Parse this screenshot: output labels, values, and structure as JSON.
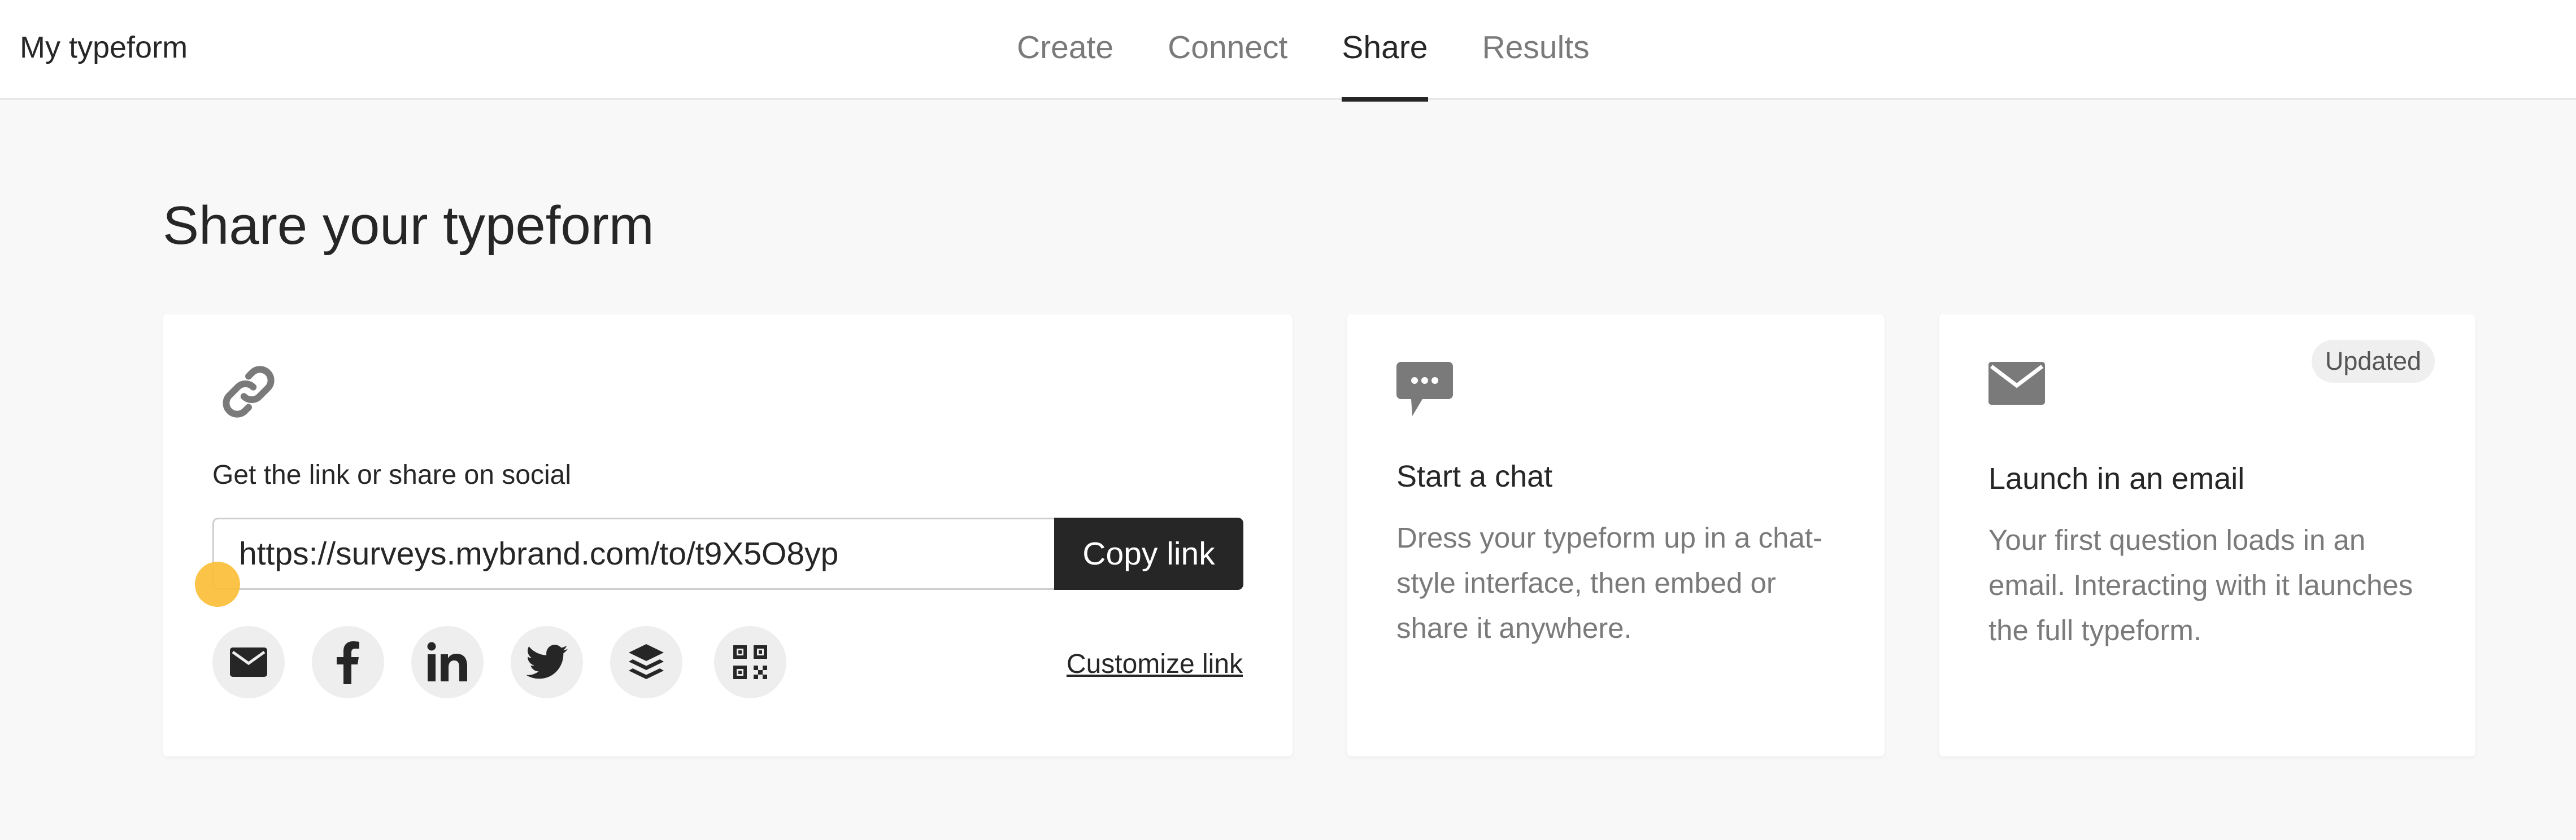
{
  "header": {
    "app_title": "My typeform",
    "tabs": [
      {
        "label": "Create",
        "active": false
      },
      {
        "label": "Connect",
        "active": false
      },
      {
        "label": "Share",
        "active": true
      },
      {
        "label": "Results",
        "active": false
      }
    ]
  },
  "page": {
    "title": "Share your typeform"
  },
  "share_card": {
    "icon": "link-icon",
    "heading": "Get the link or share on social",
    "url_value": "https://surveys.mybrand.com/to/t9X5O8yp",
    "copy_label": "Copy link",
    "social": [
      {
        "icon": "email-icon"
      },
      {
        "icon": "facebook-icon"
      },
      {
        "icon": "linkedin-icon"
      },
      {
        "icon": "twitter-icon"
      },
      {
        "icon": "buffer-icon"
      },
      {
        "icon": "qr-code-icon"
      }
    ],
    "customize_label": "Customize link"
  },
  "chat_card": {
    "icon": "chat-bubble-icon",
    "title": "Start a chat",
    "description": "Dress your typeform up in a chat-style interface, then embed or share it anywhere."
  },
  "email_card": {
    "icon": "envelope-icon",
    "badge": "Updated",
    "title": "Launch in an email",
    "description": "Your first question loads in an email. Interacting with it launches the full typeform."
  },
  "colors": {
    "background": "#f8f8f8",
    "text": "#262627",
    "muted": "#7a7a7a",
    "button": "#262627",
    "cursor": "#fbbf39"
  }
}
